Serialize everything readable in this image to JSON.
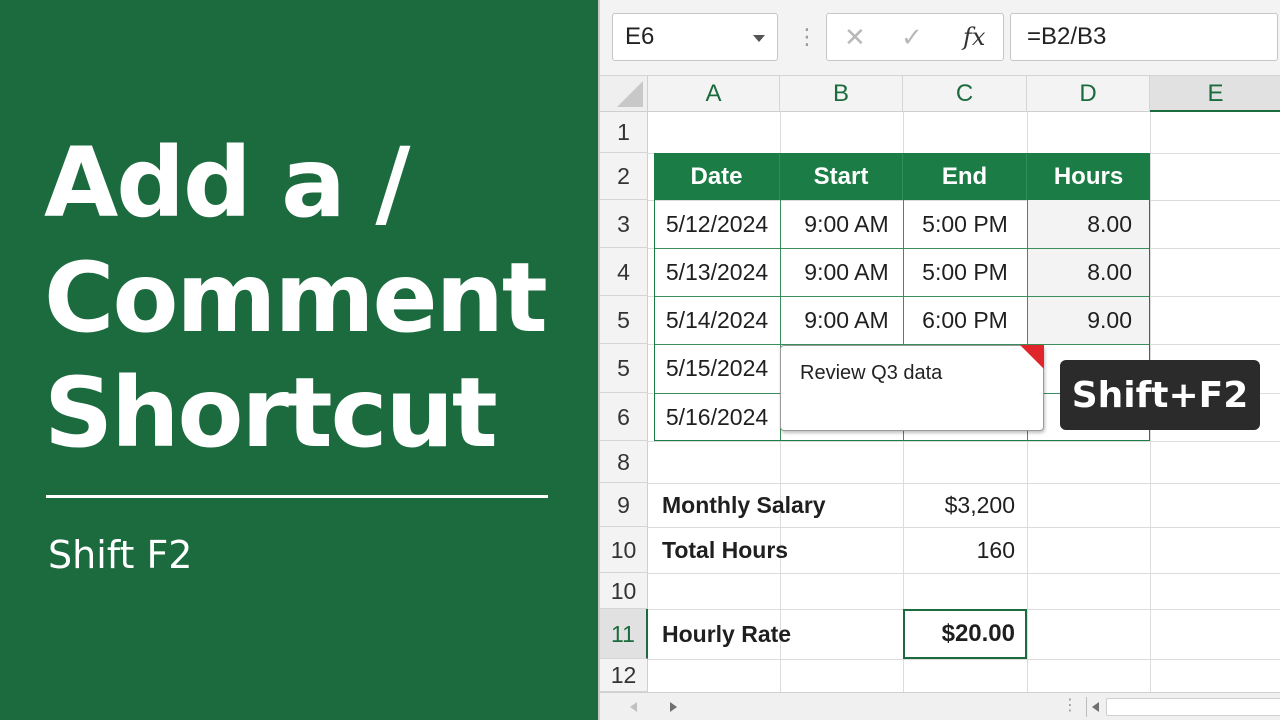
{
  "left_panel": {
    "title_lines": [
      "Add a /",
      "Comment",
      "Shortcut"
    ],
    "subtitle": "Shift F2",
    "background_color": "#1b6b3e"
  },
  "formula_bar": {
    "name_box": "E6",
    "cancel_icon": "close-icon",
    "enter_icon": "check-icon",
    "function_label": "fx",
    "formula": "=B2/B3"
  },
  "columns": [
    "A",
    "B",
    "C",
    "D",
    "E"
  ],
  "selected_column": "E",
  "row_numbers": [
    "1",
    "2",
    "3",
    "4",
    "5",
    "5",
    "6",
    "8",
    "9",
    "10",
    "10",
    "11",
    "12"
  ],
  "selected_row": "11",
  "table": {
    "headers": [
      "Date",
      "Start",
      "End",
      "Hours"
    ],
    "rows": [
      [
        "5/12/2024",
        "9:00 AM",
        "5:00 PM",
        "8.00"
      ],
      [
        "5/13/2024",
        "9:00 AM",
        "5:00 PM",
        "8.00"
      ],
      [
        "5/14/2024",
        "9:00 AM",
        "6:00 PM",
        "9.00"
      ],
      [
        "5/15/2024",
        "",
        "",
        ""
      ],
      [
        "5/16/2024",
        "",
        "",
        ""
      ]
    ]
  },
  "summary": {
    "monthly_salary_label": "Monthly Salary",
    "monthly_salary_value": "$3,200",
    "total_hours_label": "Total Hours",
    "total_hours_value": "160",
    "hourly_rate_label": "Hourly Rate",
    "hourly_rate_value": "$20.00"
  },
  "comment": {
    "text": "Review Q3 data",
    "indicator_color": "#e0262b"
  },
  "shortcut_badge": "Shift+F2",
  "colors": {
    "accent": "#1b6b3e",
    "table_header": "#1b7d45"
  }
}
